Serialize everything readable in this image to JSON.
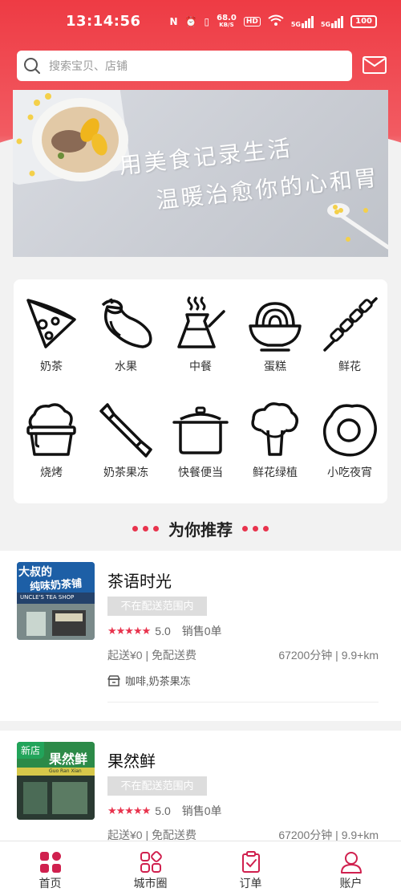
{
  "status_bar": {
    "time": "13:14:56",
    "net_speed": "68.0",
    "net_unit": "KB/S",
    "hd": "HD",
    "sig1": "5G",
    "sig2": "5G",
    "battery": "100"
  },
  "search": {
    "placeholder": "搜索宝贝、店铺"
  },
  "banner": {
    "line1": "用美食记录生活",
    "line2": "温暖治愈你的心和胃"
  },
  "categories": [
    {
      "label": "奶茶",
      "icon": "pizza-slice-icon"
    },
    {
      "label": "水果",
      "icon": "eggplant-icon"
    },
    {
      "label": "中餐",
      "icon": "coffee-pot-icon"
    },
    {
      "label": "蛋糕",
      "icon": "noodle-bowl-icon"
    },
    {
      "label": "鲜花",
      "icon": "kebab-skewer-icon"
    },
    {
      "label": "烧烤",
      "icon": "ice-cream-bucket-icon"
    },
    {
      "label": "奶茶果冻",
      "icon": "candy-icon"
    },
    {
      "label": "快餐便当",
      "icon": "cooking-pot-icon"
    },
    {
      "label": "鲜花绿植",
      "icon": "broccoli-icon"
    },
    {
      "label": "小吃夜宵",
      "icon": "fried-egg-icon"
    }
  ],
  "section": {
    "title": "为你推荐"
  },
  "shops": [
    {
      "name": "茶语时光",
      "range_status": "不在配送范围内",
      "rating": "5.0",
      "sales": "销售0单",
      "delivery": "起送¥0 | 免配送费",
      "distance": "67200分钟 | 9.9+km",
      "tags": "咖啡,奶茶果冻",
      "sign_text_1": "大叔的",
      "sign_text_2": "纯味奶茶铺",
      "sign_text_3": "UNCLE'S TEA SHOP"
    },
    {
      "name": "果然鲜",
      "badge": "新店",
      "range_status": "不在配送范围内",
      "rating": "5.0",
      "sales": "销售0单",
      "delivery": "起送¥0 | 免配送费",
      "distance": "67200分钟 | 9.9+km",
      "sign_text_1": "果然鲜",
      "sign_text_2": "Guo Ran Xian"
    }
  ],
  "nav": [
    {
      "label": "首页",
      "icon": "home-grid-icon",
      "active": true
    },
    {
      "label": "城市圈",
      "icon": "city-circle-icon",
      "active": false
    },
    {
      "label": "订单",
      "icon": "order-clipboard-icon",
      "active": false
    },
    {
      "label": "账户",
      "icon": "account-person-icon",
      "active": false
    }
  ],
  "colors": {
    "brand_red": "#ee3b44",
    "accent": "#e8334d",
    "nav_active": "#d0204e"
  }
}
